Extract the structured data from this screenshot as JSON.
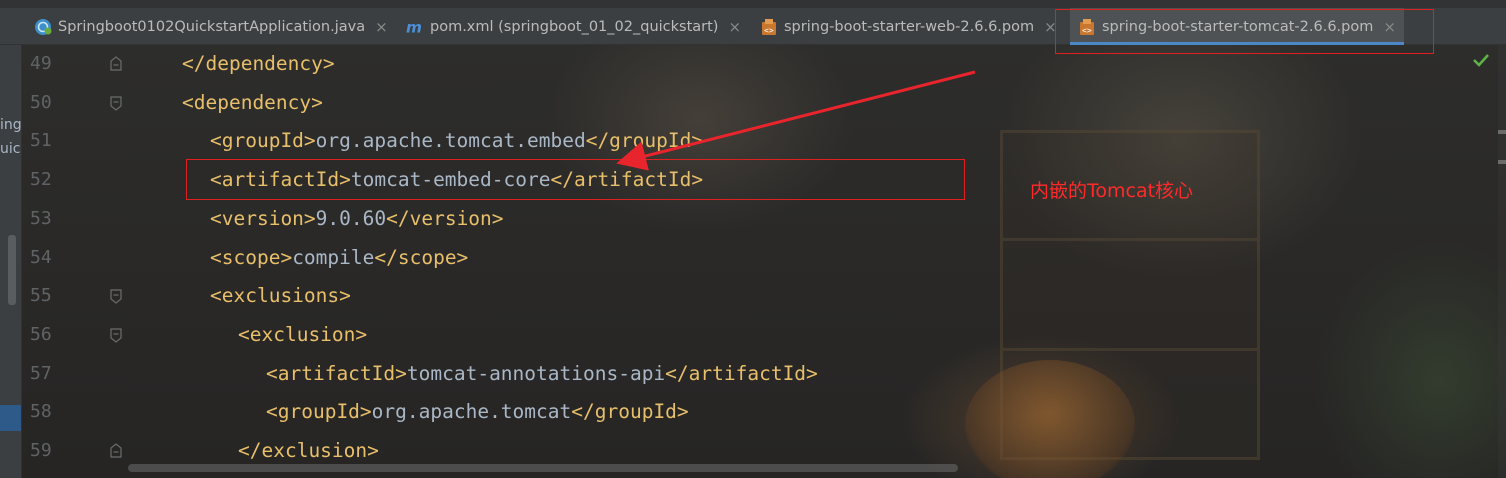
{
  "tabs": [
    {
      "label": "Springboot0102QuickstartApplication.java",
      "icon": "spring-class-icon",
      "active": false
    },
    {
      "label": "pom.xml (springboot_01_02_quickstart)",
      "icon": "maven-icon",
      "active": false
    },
    {
      "label": "spring-boot-starter-web-2.6.6.pom",
      "icon": "xml-file-icon",
      "active": false
    },
    {
      "label": "spring-boot-starter-tomcat-2.6.6.pom",
      "icon": "xml-file-icon",
      "active": true
    }
  ],
  "tab_close_glyph": "×",
  "left_panel": {
    "fragments": [
      "ing",
      "uick"
    ]
  },
  "editor": {
    "lines": [
      {
        "no": "49",
        "segments": [
          {
            "t": "tag",
            "v": "</dependency>"
          }
        ]
      },
      {
        "no": "50",
        "segments": [
          {
            "t": "tag",
            "v": "<dependency>"
          }
        ]
      },
      {
        "no": "51",
        "segments": [
          {
            "t": "tag",
            "v": "<groupId>"
          },
          {
            "t": "txt",
            "v": "org.apache.tomcat.embed"
          },
          {
            "t": "tag",
            "v": "</groupId>"
          }
        ]
      },
      {
        "no": "52",
        "segments": [
          {
            "t": "tag",
            "v": "<artifactId>"
          },
          {
            "t": "txt",
            "v": "tomcat-embed-core"
          },
          {
            "t": "tag",
            "v": "</artifactId>"
          }
        ]
      },
      {
        "no": "53",
        "segments": [
          {
            "t": "tag",
            "v": "<version>"
          },
          {
            "t": "txt",
            "v": "9.0.60"
          },
          {
            "t": "tag",
            "v": "</version>"
          }
        ]
      },
      {
        "no": "54",
        "segments": [
          {
            "t": "tag",
            "v": "<scope>"
          },
          {
            "t": "txt",
            "v": "compile"
          },
          {
            "t": "tag",
            "v": "</scope>"
          }
        ]
      },
      {
        "no": "55",
        "segments": [
          {
            "t": "tag",
            "v": "<exclusions>"
          }
        ]
      },
      {
        "no": "56",
        "segments": [
          {
            "t": "tag",
            "v": "<exclusion>"
          }
        ]
      },
      {
        "no": "57",
        "segments": [
          {
            "t": "tag",
            "v": "<artifactId>"
          },
          {
            "t": "txt",
            "v": "tomcat-annotations-api"
          },
          {
            "t": "tag",
            "v": "</artifactId>"
          }
        ]
      },
      {
        "no": "58",
        "segments": [
          {
            "t": "tag",
            "v": "<groupId>"
          },
          {
            "t": "txt",
            "v": "org.apache.tomcat"
          },
          {
            "t": "tag",
            "v": "</groupId>"
          }
        ]
      },
      {
        "no": "59",
        "segments": [
          {
            "t": "tag",
            "v": "</exclusion>"
          }
        ]
      }
    ]
  },
  "annotation": {
    "text": "内嵌的Tomcat核心",
    "color": "#ff2a2a"
  },
  "colors": {
    "tag": "#e8bf6a",
    "text": "#a9b7c6",
    "line_number": "#606366",
    "active_tab_underline": "#4a88c7",
    "annotation_red": "#e02020"
  }
}
